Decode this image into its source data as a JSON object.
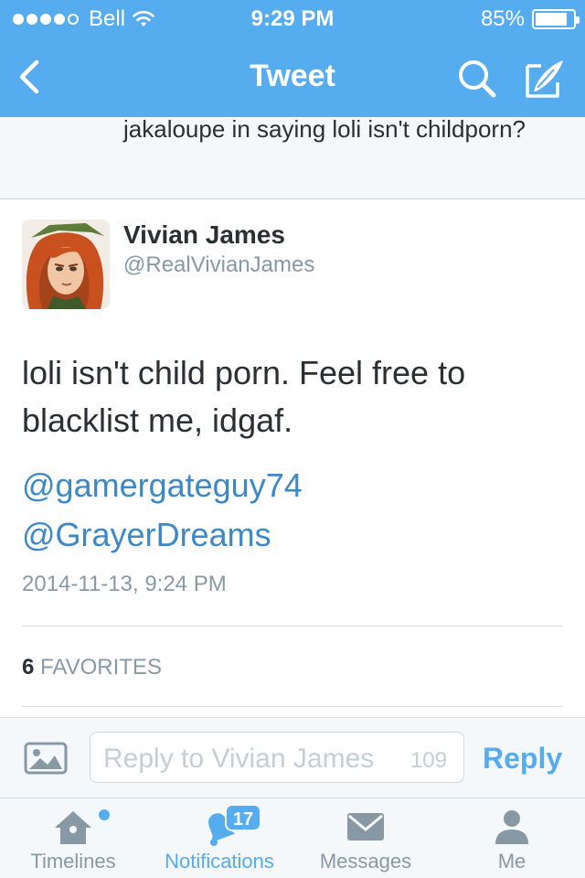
{
  "status_bar": {
    "carrier": "Bell",
    "signal_bars_filled": 4,
    "signal_bars_total": 5,
    "time": "9:29 PM",
    "battery_percent": "85%",
    "battery_level": 0.85
  },
  "nav": {
    "back_icon": "chevron-left-icon",
    "title": "Tweet",
    "search_icon": "search-icon",
    "compose_icon": "compose-quill-icon"
  },
  "previous_tweet": {
    "text": "jakaloupe in saying loli isn't childporn?"
  },
  "tweet": {
    "author_name": "Vivian James",
    "author_handle": "@RealVivianJames",
    "text": "loli isn't child porn. Feel free to blacklist me, idgaf.",
    "mentions": [
      "@gamergateguy74",
      "@GrayerDreams"
    ],
    "timestamp": "2014-11-13, 9:24 PM",
    "favorites_count": "6",
    "favorites_label": "FAVORITES"
  },
  "reply_bar": {
    "photo_icon": "photo-icon",
    "placeholder": "Reply to Vivian James",
    "char_counter": "109",
    "reply_label": "Reply"
  },
  "tab_bar": {
    "tabs": [
      {
        "label": "Timelines",
        "icon": "home-icon",
        "has_new_dot": true
      },
      {
        "label": "Notifications",
        "icon": "bell-icon",
        "badge": "17",
        "active": true
      },
      {
        "label": "Messages",
        "icon": "envelope-icon"
      },
      {
        "label": "Me",
        "icon": "person-icon"
      }
    ]
  },
  "colors": {
    "accent": "#55acee",
    "link": "#3d88c8",
    "text": "#292f33",
    "muted": "#8899a6"
  }
}
